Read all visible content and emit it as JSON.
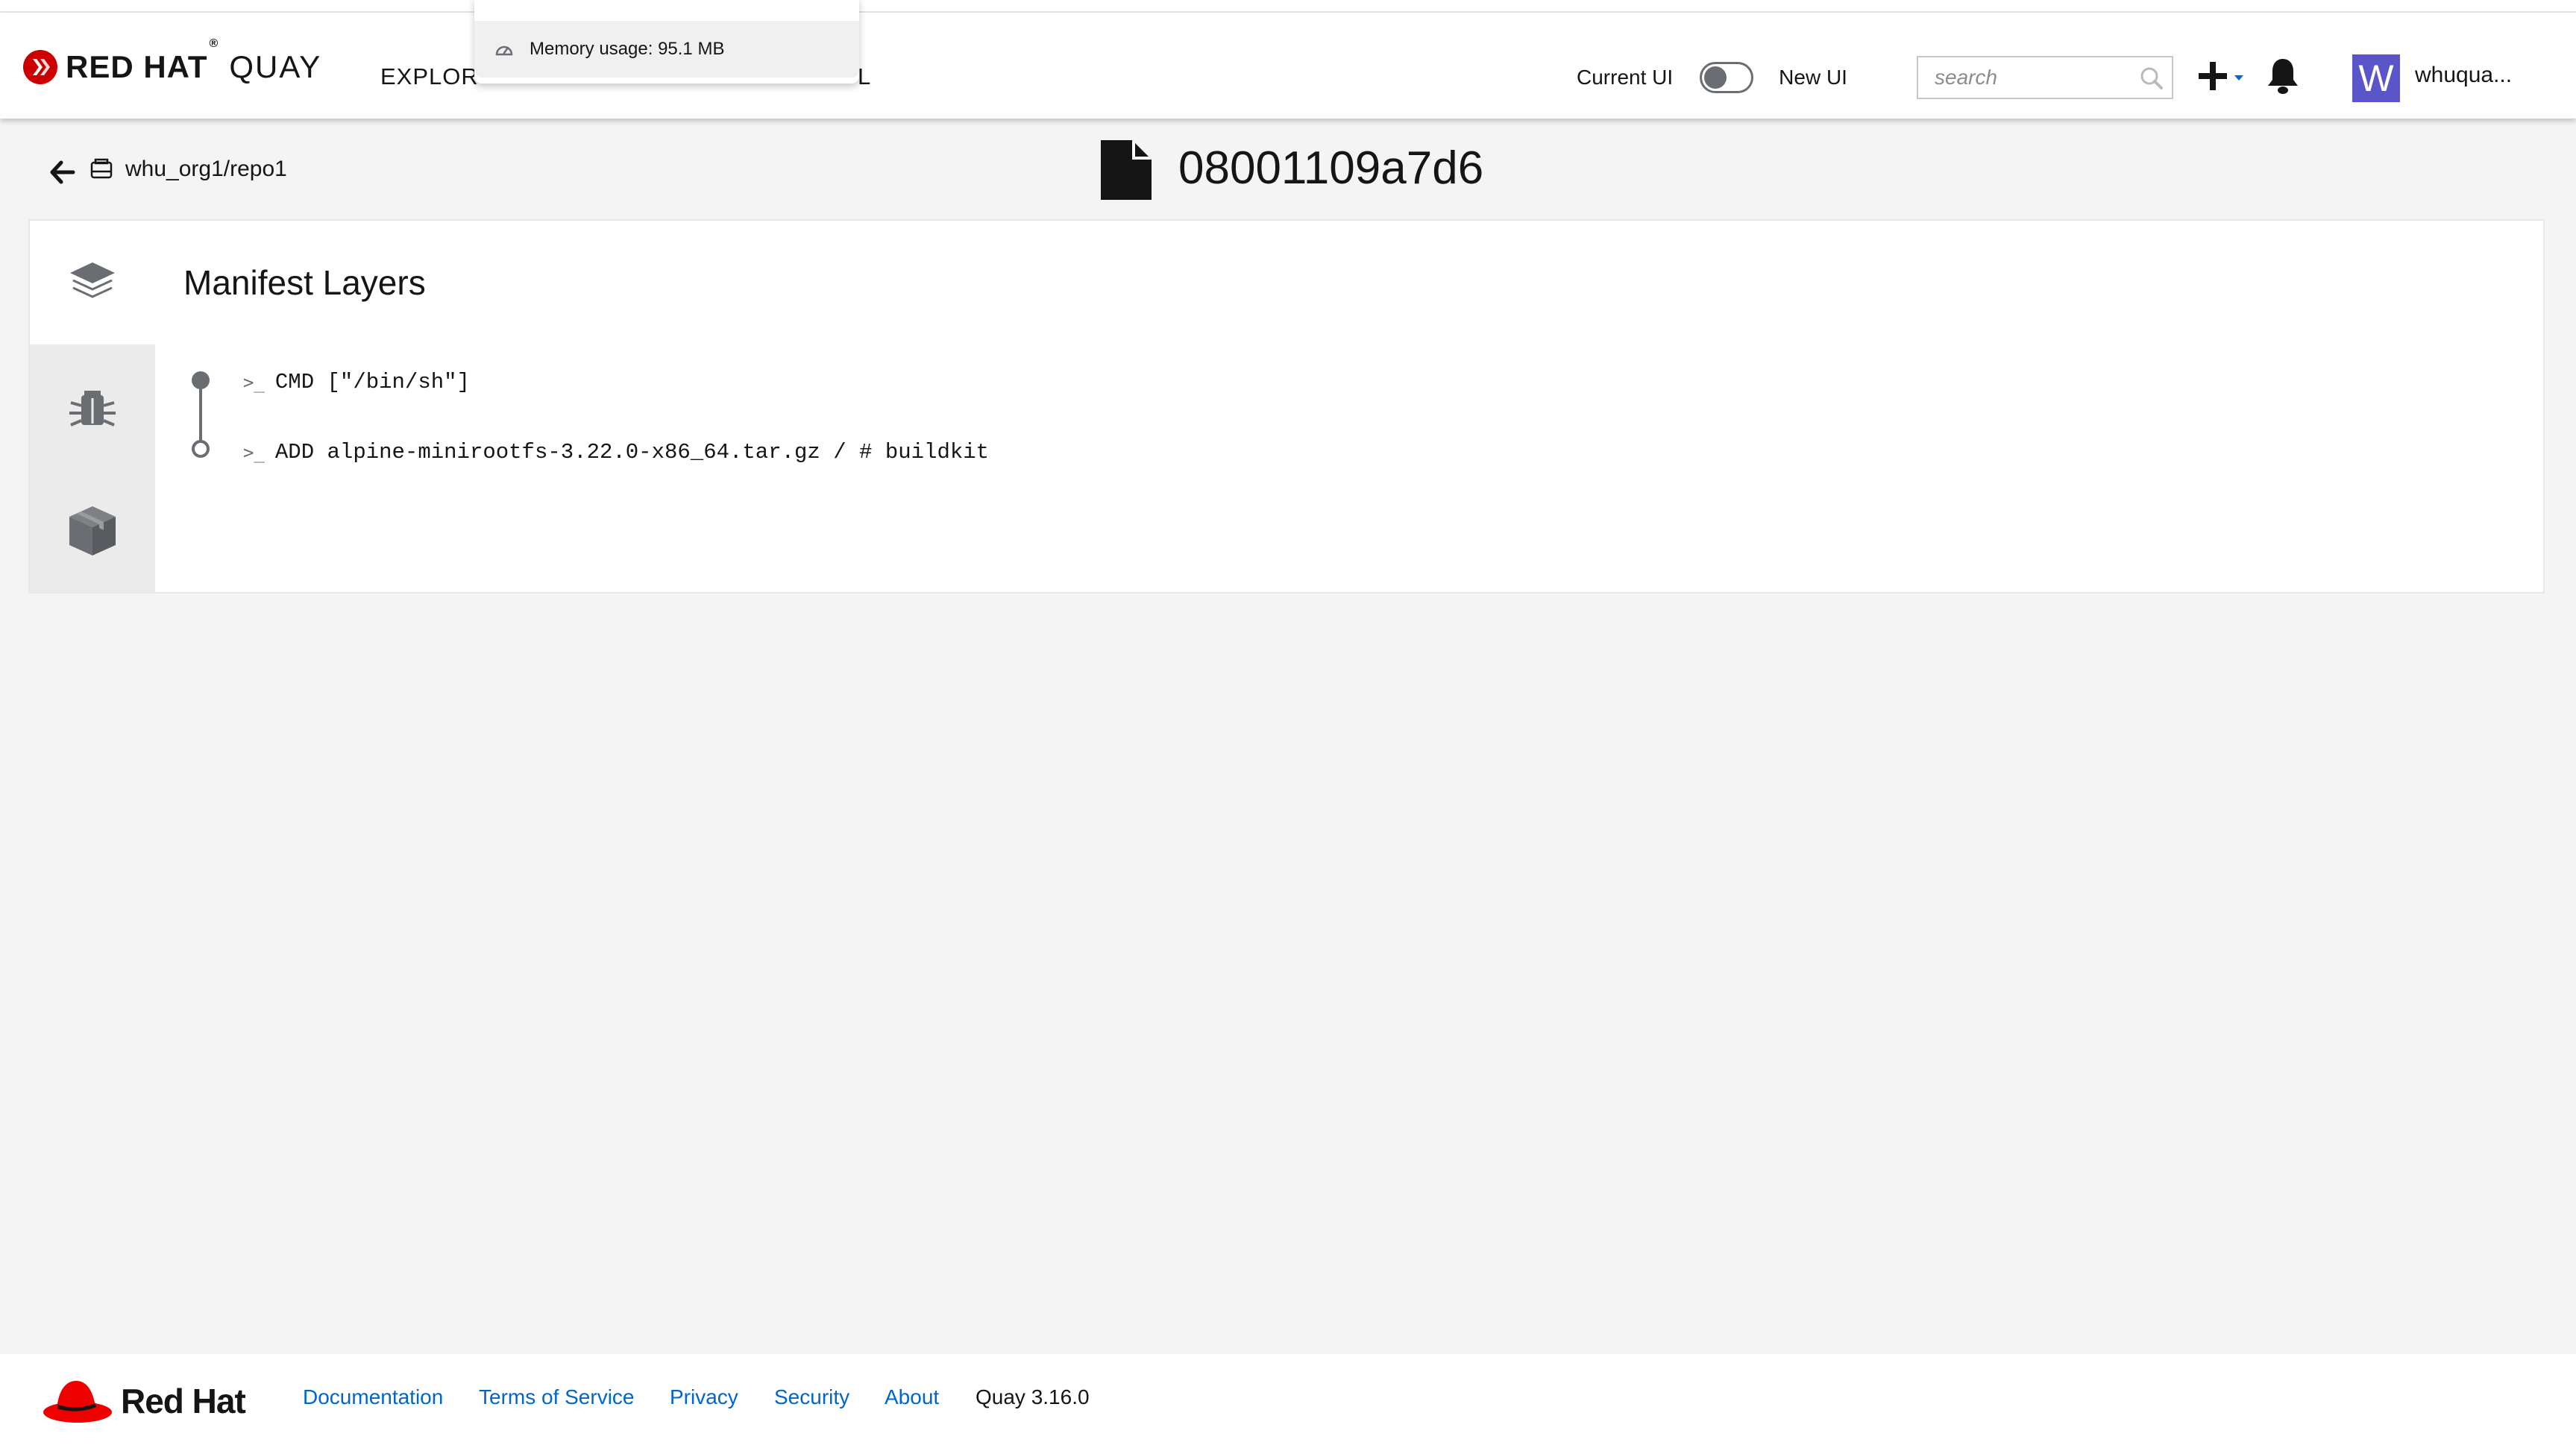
{
  "navbar": {
    "brand_name": "RED HAT",
    "brand_reg": "®",
    "product_name": "QUAY",
    "nav_items": [
      "EXPLOR",
      "L"
    ],
    "toggle_current_label": "Current UI",
    "toggle_new_label": "New UI",
    "search_placeholder": "search",
    "avatar_letter": "W",
    "username": "whuqua..."
  },
  "memory_popover": {
    "text": "Memory usage: 95.1 MB"
  },
  "header": {
    "repo_path": "whu_org1/repo1",
    "manifest_digest": "08001109a7d6"
  },
  "card": {
    "title": "Manifest Layers",
    "layers": [
      {
        "command": "CMD [\"/bin/sh\"]"
      },
      {
        "command": "ADD alpine-minirootfs-3.22.0-x86_64.tar.gz / # buildkit"
      }
    ],
    "prompt_glyph": ">_"
  },
  "footer": {
    "logo_text": "Red Hat",
    "links": [
      "Documentation",
      "Terms of Service",
      "Privacy",
      "Security",
      "About"
    ],
    "version": "Quay 3.16.0"
  },
  "colors": {
    "accent_link": "#0066cc",
    "avatar_bg": "#5a55c8",
    "redhat_red": "#ee0000"
  }
}
